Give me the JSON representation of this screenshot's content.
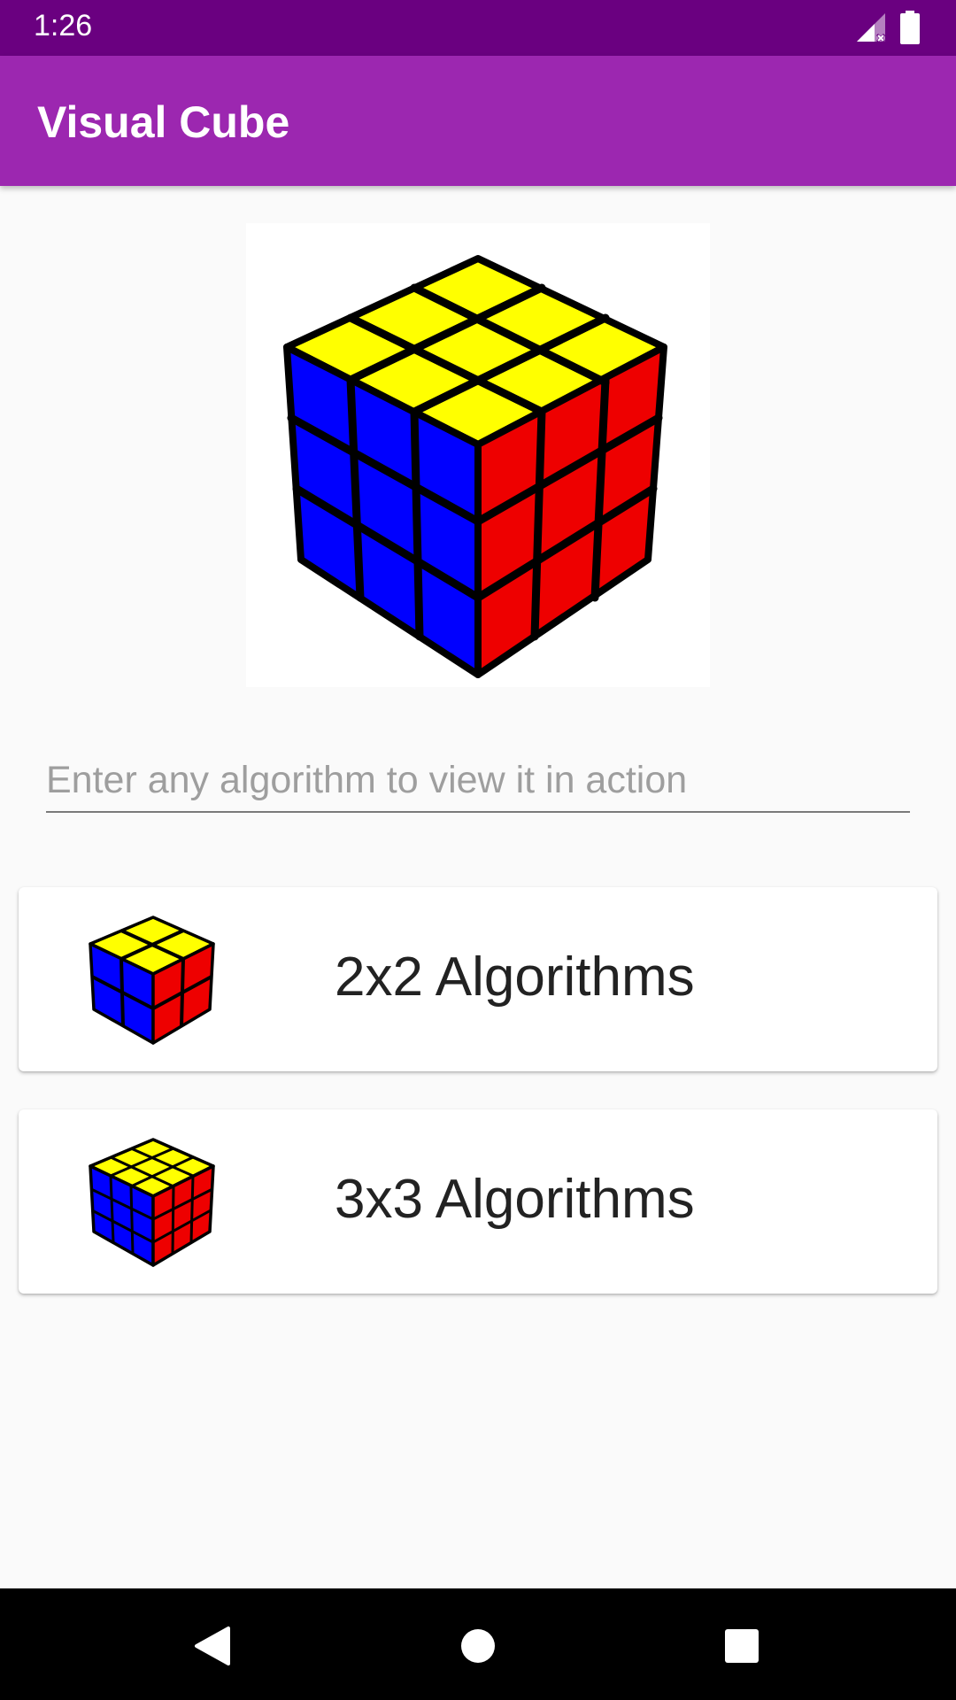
{
  "status_bar": {
    "time": "1:26",
    "icons": [
      "signal-icon",
      "battery-icon"
    ]
  },
  "app_bar": {
    "title": "Visual Cube"
  },
  "hero": {
    "icon": "rubiks-cube-3x3-icon"
  },
  "algorithm_input": {
    "value": "",
    "placeholder": "Enter any algorithm to view it in action"
  },
  "cards": [
    {
      "label": "2x2 Algorithms",
      "icon": "rubiks-cube-2x2-icon"
    },
    {
      "label": "3x3 Algorithms",
      "icon": "rubiks-cube-3x3-icon"
    }
  ],
  "nav_bar": {
    "buttons": [
      "back-icon",
      "home-icon",
      "recents-icon"
    ]
  },
  "colors": {
    "status_bar": "#6a0080",
    "app_bar": "#9c27b0",
    "cube_top": "#ffff00",
    "cube_left": "#0000ff",
    "cube_right": "#ee0000"
  }
}
